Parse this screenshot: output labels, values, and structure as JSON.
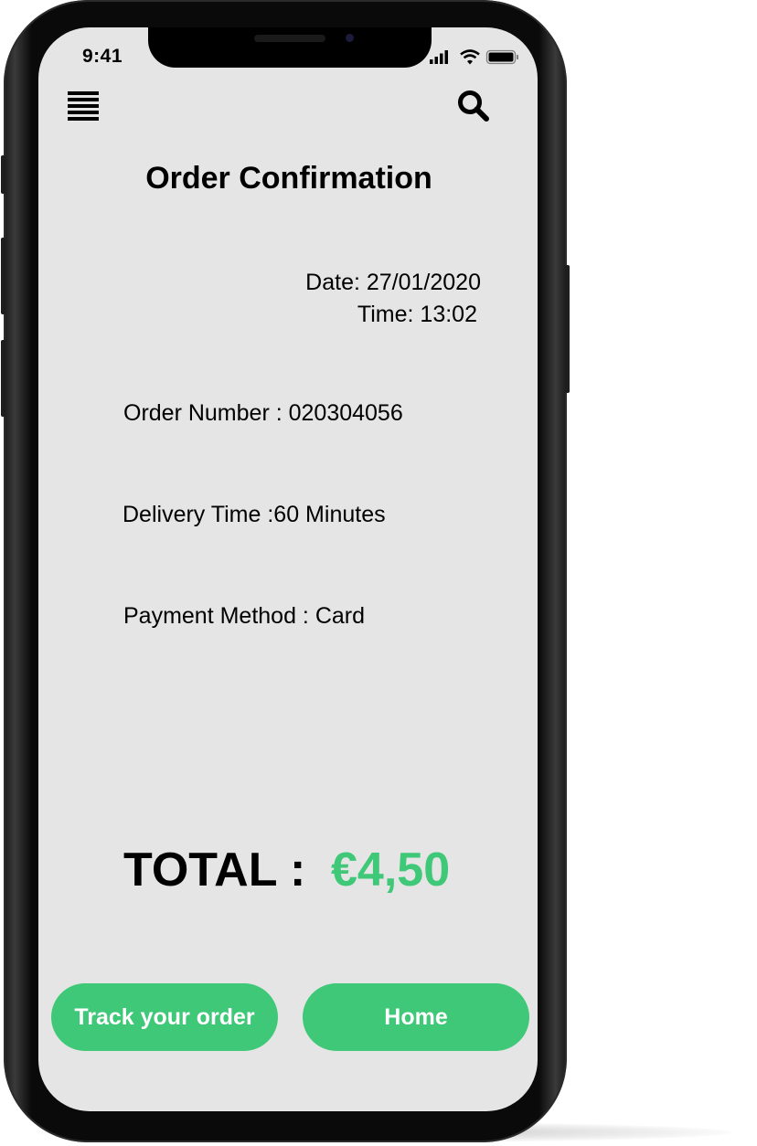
{
  "status_bar": {
    "time": "9:41"
  },
  "header": {
    "title": "Order Confirmation"
  },
  "order": {
    "date_text": "Date: 27/01/2020",
    "time_text": "Time: 13:02",
    "order_number": "Order Number : 020304056",
    "delivery_time": "Delivery Time :60 Minutes",
    "payment_method": "Payment Method : Card"
  },
  "total": {
    "label": "TOTAL :",
    "value": "€4,50"
  },
  "buttons": {
    "track": "Track your order",
    "home": "Home"
  },
  "colors": {
    "accent": "#3ec877",
    "screen_bg": "#e5e5e5"
  },
  "icons": [
    "menu-icon",
    "search-icon",
    "signal-icon",
    "wifi-icon",
    "battery-icon"
  ]
}
